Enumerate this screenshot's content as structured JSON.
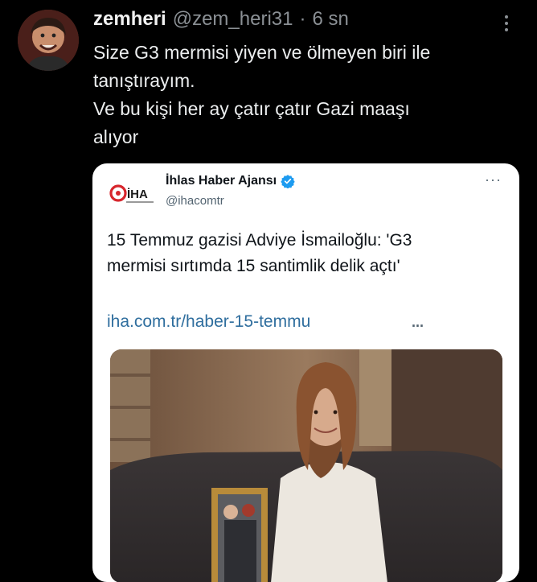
{
  "tweet": {
    "author": {
      "display_name": "zemheri",
      "handle": "@zem_heri31",
      "separator": "·",
      "time": "6 sn"
    },
    "text_lines": [
      "Size G3 mermisi yiyen ve ölmeyen biri ile",
      "tanıştırayım.",
      "Ve bu kişi her ay çatır çatır Gazi maaşı",
      "alıyor"
    ]
  },
  "quoted_post": {
    "logo_text": "İHA",
    "name": "İhlas Haber Ajansı",
    "handle": "@ihacomtr",
    "more": "···",
    "title_lines": [
      "15 Temmuz gazisi Adviye İsmailoğlu: 'G3",
      "mermisi sırtımda 15 santimlik delik açtı'"
    ],
    "link": "iha.com.tr/haber-15-temmu",
    "link_more": "..."
  },
  "colors": {
    "background": "#000000",
    "secondary_text": "#8b9095",
    "link": "#2f6e9e",
    "verified": "#1d9bf0",
    "logo_red": "#d7262d"
  },
  "icons": [
    "avatar-image",
    "more-vertical-icon",
    "iha-logo",
    "verified-badge-icon",
    "news-photo"
  ]
}
